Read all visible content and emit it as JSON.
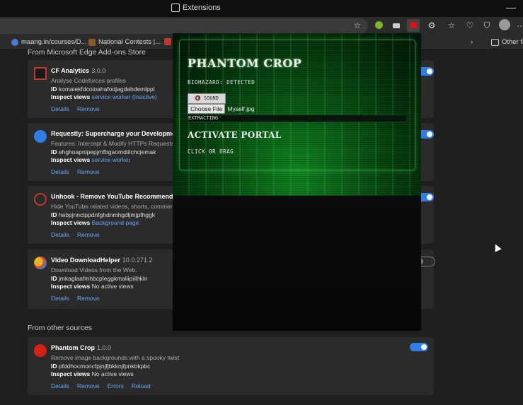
{
  "titlebar": {
    "title": "Extensions",
    "minimize": "—"
  },
  "toolbar": {
    "icons": [
      "star-icon",
      "extension-green-icon",
      "camera-icon",
      "phantom-crop-icon",
      "extensions-icon",
      "favorites-icon",
      "heart-pulse-icon",
      "shield-icon",
      "profile-icon",
      "more-icon"
    ],
    "more": "···"
  },
  "bookmarks": {
    "items": [
      {
        "label": "maang.in/courses/D...",
        "color": "#4b7bd9"
      },
      {
        "label": "National Contests |...",
        "color": "#8a5a2b"
      }
    ],
    "other": "Other fa",
    "chevron": "›"
  },
  "store_section": "From Microsoft Edge Add-ons Store",
  "other_section": "From other sources",
  "cards": [
    {
      "name": "CF Analytics",
      "version": "3.0.0",
      "desc": "Analyse Codeforces profiles",
      "id_label": "ID",
      "id": "komaiekfdcoioahafodjagdahdemlppl",
      "inspect_label": "Inspect views",
      "inspect_value": "service worker (Inactive)",
      "links": [
        "Details",
        "Remove"
      ],
      "enabled": true,
      "logo_color": "#c0392b"
    },
    {
      "name": "Requestly: Supercharge your Development &",
      "version": "",
      "desc": "Features: Intercept & Modify HTTPs Requests,",
      "id_label": "ID",
      "id": "ehghoapnlpepjmfbgaomdiilchcjemak",
      "inspect_label": "Inspect views",
      "inspect_value": "service worker",
      "links": [
        "Details",
        "Remove"
      ],
      "enabled": true,
      "logo_color": "#2f7de1"
    },
    {
      "name": "Unhook - Remove YouTube Recommended &",
      "version": "",
      "desc": "Hide YouTube related videos, shorts, comment",
      "id_label": "ID",
      "id": "hebpjnnclppdnfghdnmhgdljmjpfhggk",
      "inspect_label": "Inspect views",
      "inspect_value": "Background page",
      "links": [
        "Details",
        "Remove"
      ],
      "enabled": true,
      "logo_color": "#c0392b"
    },
    {
      "name": "Video DownloadHelper",
      "version": "10.0.271.2",
      "desc": "Download Videos from the Web.",
      "id_label": "ID",
      "id": "jmkaglaafmhbcpleggkmaliipiilhkln",
      "inspect_label": "Inspect views",
      "inspect_value": "No active views",
      "links": [
        "Details",
        "Remove"
      ],
      "enabled": false,
      "logo_color": "#e6b422"
    },
    {
      "name": "Phantom Crop",
      "version": "1.0.0",
      "desc": "Remove image backgrounds with a spooky twist",
      "id_label": "ID",
      "id": "pfddhocmoncfpjnjfjbkknjfpnkbkpbc",
      "inspect_label": "Inspect views",
      "inspect_value": "No active views",
      "links": [
        "Details",
        "Remove",
        "Errors",
        "Reload"
      ],
      "enabled": true,
      "logo_color": "#d91e18"
    }
  ],
  "popup": {
    "title": "PHANTOM CROP",
    "status": "BIOHAZARD: DETECTED",
    "sound_label": "🔇 SOUND",
    "choose_file": "Choose File",
    "file_name": "Myself.jpg",
    "extract_status": "EXTRACTING",
    "activate": "ACTIVATE PORTAL",
    "click_drag": "CLICK OR DRAG"
  }
}
